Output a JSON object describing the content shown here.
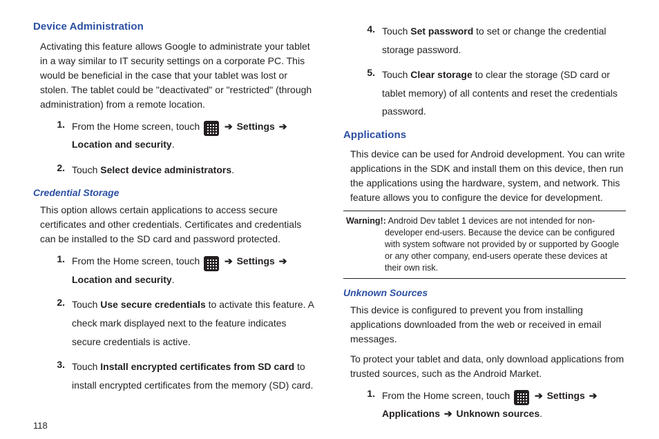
{
  "page_number": "118",
  "left": {
    "device_admin": {
      "heading": "Device Administration",
      "intro": "Activating this feature allows Google to administrate your tablet in a way similar to IT security settings on a corporate PC. This would be beneficial in the case that your tablet was lost or stolen. The tablet could be \"deactivated\" or \"restricted\" (through administration) from a remote location.",
      "steps": [
        {
          "num": "1.",
          "prefix": "From the Home screen, touch ",
          "icon": "apps-icon",
          "arrow1": " ➔ ",
          "b1": "Settings",
          "arrow2": " ➔ ",
          "b2": "Location and security",
          "suffix": "."
        },
        {
          "num": "2.",
          "prefix": "Touch ",
          "b1": "Select device administrators",
          "suffix": "."
        }
      ]
    },
    "cred_storage": {
      "heading": "Credential Storage",
      "intro": "This option allows certain applications to access secure certificates and other credentials. Certificates and credentials can be installed to the SD card and password protected.",
      "steps": [
        {
          "num": "1.",
          "prefix": "From the Home screen, touch ",
          "icon": "apps-icon",
          "arrow1": " ➔ ",
          "b1": "Settings",
          "arrow2": " ➔ ",
          "b2": "Location and security",
          "suffix": "."
        },
        {
          "num": "2.",
          "prefix": "Touch ",
          "b1": "Use secure credentials",
          "suffix": " to activate this feature. A check mark displayed next to the feature indicates secure credentials is active."
        },
        {
          "num": "3.",
          "prefix": "Touch ",
          "b1": "Install encrypted certificates from SD card",
          "suffix": " to install encrypted certificates from the memory (SD) card."
        }
      ]
    }
  },
  "right": {
    "cont_steps": [
      {
        "num": "4.",
        "prefix": "Touch ",
        "b1": "Set password",
        "suffix": " to set or change the credential storage password."
      },
      {
        "num": "5.",
        "prefix": "Touch ",
        "b1": "Clear storage",
        "suffix": " to clear the storage (SD card or tablet memory) of all contents and reset the credentials password."
      }
    ],
    "applications": {
      "heading": "Applications",
      "intro": "This device can be used for Android development. You can write applications in the SDK and install them on this device, then run the applications using the hardware, system, and network. This feature allows you to configure the device for development."
    },
    "warning": {
      "label": "Warning!:",
      "text": " Android Dev tablet 1 devices are not intended for non-developer end-users. Because the device can be configured with system software not provided by or supported by Google or any other company, end-users operate these devices at their own risk."
    },
    "unknown_sources": {
      "heading": "Unknown Sources",
      "p1": "This device is configured to prevent you from installing applications downloaded from the web or received in email messages.",
      "p2": "To protect your tablet and data, only download applications from trusted sources, such as the Android Market.",
      "step": {
        "num": "1.",
        "prefix": "From the Home screen, touch ",
        "icon": "apps-icon",
        "arrow1": " ➔ ",
        "b1": "Settings",
        "arrow2": " ➔ ",
        "b2": "Applications ",
        "arrow3": " ➔ ",
        "b3": "Unknown sources",
        "suffix": "."
      }
    }
  }
}
